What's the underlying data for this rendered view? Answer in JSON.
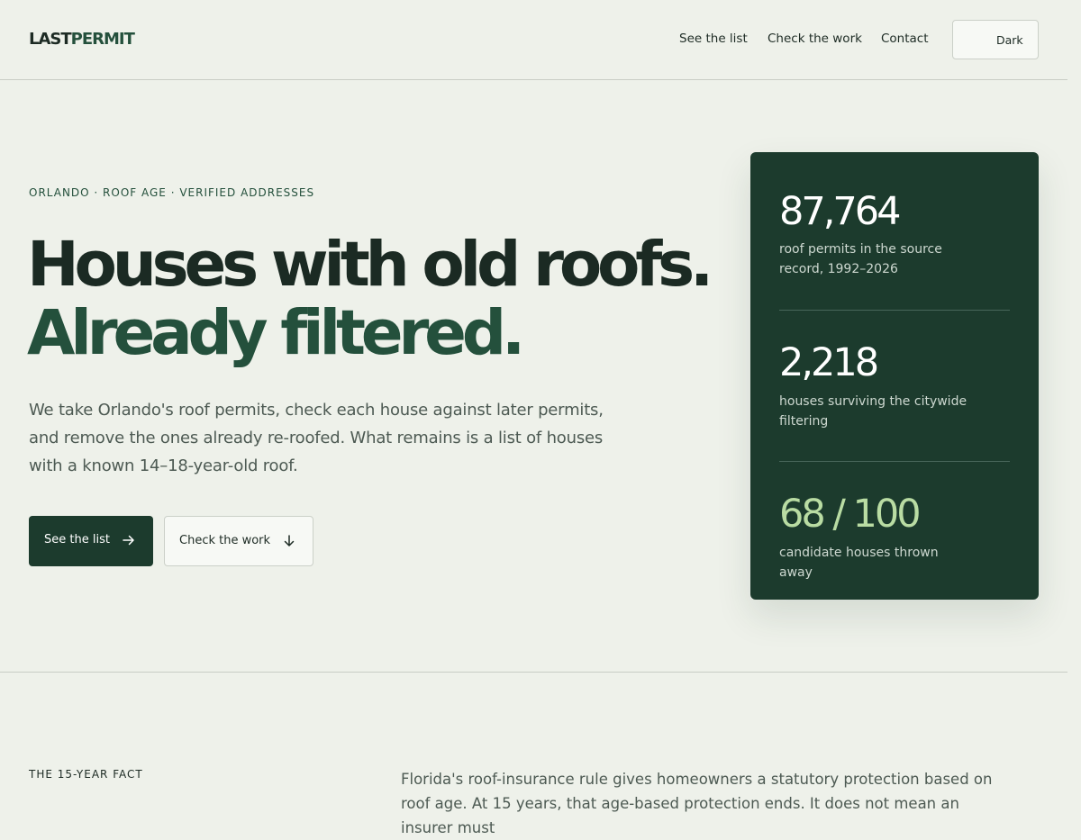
{
  "header": {
    "logo_part1": "LAST",
    "logo_part2": "PERMIT",
    "nav": [
      "See the list",
      "Check the work",
      "Contact"
    ],
    "theme_toggle": "Dark"
  },
  "hero": {
    "eyebrow": "ORLANDO · ROOF AGE · VERIFIED ADDRESSES",
    "headline_line1": "Houses with old roofs.",
    "headline_line2": "Already filtered.",
    "lede": "We take Orlando's roof permits, check each house against later permits, and remove the ones already re-roofed. What remains is a list of houses with a known 14–18-year-old roof.",
    "primary_button": "See the list",
    "secondary_button": "Check the work"
  },
  "stats": [
    {
      "value": "87,764",
      "label": "roof permits in the source record, 1992–2026"
    },
    {
      "value": "2,218",
      "label": "houses surviving the citywide filtering"
    },
    {
      "value": "68 / 100",
      "label": "candidate houses thrown away"
    }
  ],
  "section": {
    "eyebrow": "THE 15-YEAR FACT",
    "body": "Florida's roof-insurance rule gives homeowners a statutory protection based on roof age. At 15 years, that age-based protection ends. It does not mean an insurer must"
  },
  "colors": {
    "background": "#eef1ea",
    "card": "#1c3b2d",
    "accent_green": "#24503c",
    "stat_highlight": "#b9dca3"
  },
  "icons": {
    "primary_button": "arrow-right-icon",
    "secondary_button": "arrow-down-icon"
  }
}
